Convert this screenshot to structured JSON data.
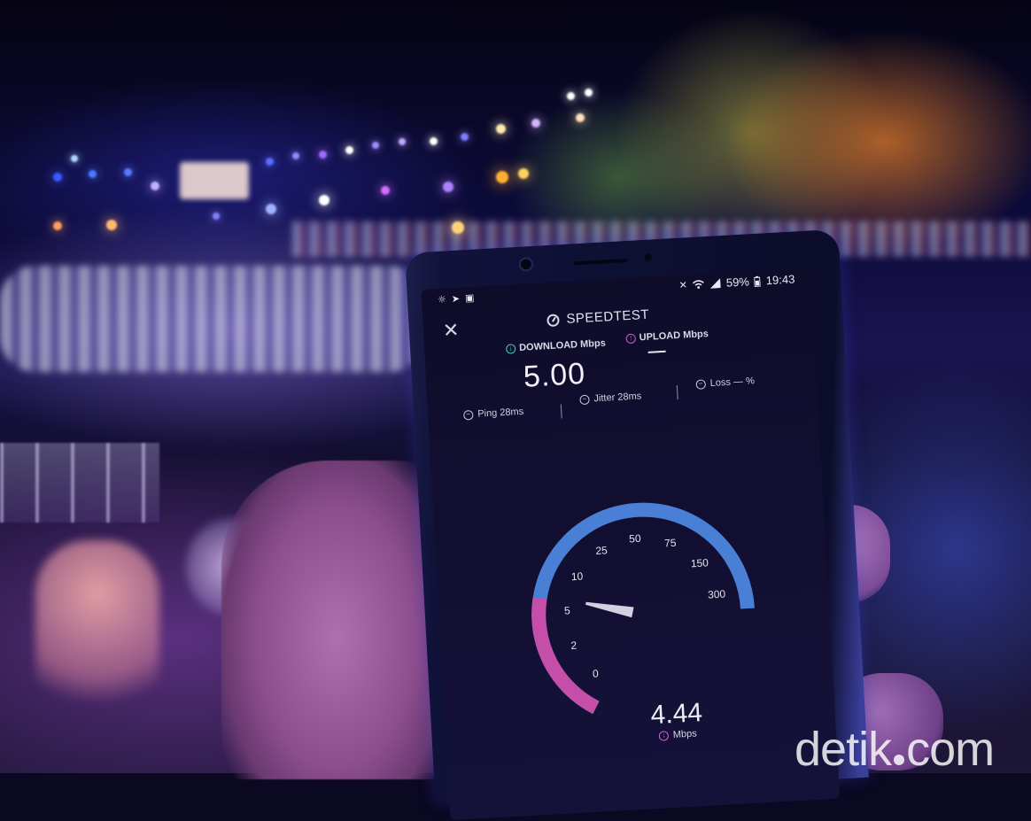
{
  "status_bar": {
    "battery": "59%",
    "time": "19:43"
  },
  "app": {
    "title": "SPEEDTEST",
    "close_symbol": "✕"
  },
  "download": {
    "label": "DOWNLOAD Mbps",
    "value": "5.00"
  },
  "upload": {
    "label": "UPLOAD Mbps",
    "value": "—"
  },
  "metrics": {
    "ping": "Ping 28ms",
    "jitter": "Jitter 28ms",
    "loss": "Loss — %"
  },
  "gauge": {
    "ticks": [
      "0",
      "2",
      "5",
      "10",
      "25",
      "50",
      "75",
      "150",
      "300"
    ],
    "current_reading": "4.44",
    "unit": "Mbps",
    "progress_fraction": 0.3,
    "colors": {
      "progress": "#c44ea8",
      "track": "#4a7fd6",
      "needle": "#e9e6f5"
    }
  },
  "watermark": {
    "part1": "detik",
    "part2": "com"
  },
  "icons": [
    "brightness-icon",
    "navigation-icon",
    "image-icon",
    "mute-icon",
    "wifi-icon",
    "signal-icon",
    "battery-icon",
    "close-icon",
    "speedtest-gauge-icon",
    "download-icon",
    "upload-icon",
    "ping-icon",
    "jitter-icon",
    "loss-icon"
  ]
}
